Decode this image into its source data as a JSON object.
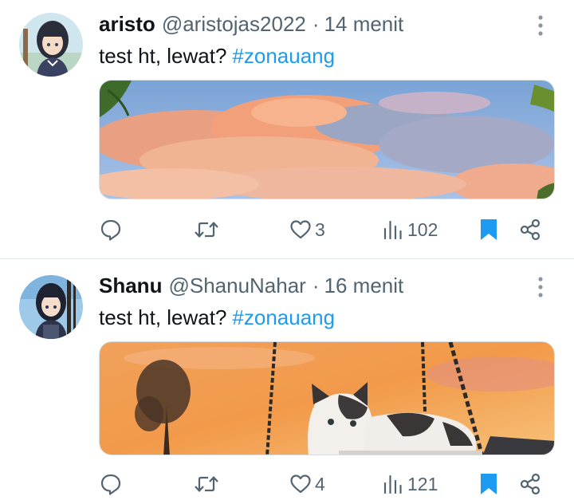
{
  "tweets": [
    {
      "display_name": "aristo",
      "handle": "@aristojas2022",
      "separator": "·",
      "time": "14 menit",
      "text": "test ht, lewat?",
      "hashtag": "#zonauang",
      "media_description": "sunset-clouds-photo",
      "reply_icon": "reply-icon",
      "retweet_icon": "retweet-icon",
      "like_icon": "heart-icon",
      "like_count": "3",
      "views_icon": "views-icon",
      "view_count": "102",
      "bookmark_icon": "bookmark-icon",
      "bookmark_color": "#1d9bf0",
      "share_icon": "share-icon"
    },
    {
      "display_name": "Shanu",
      "handle": "@ShanuNahar",
      "separator": "·",
      "time": "16 menit",
      "text": "test ht, lewat?",
      "hashtag": "#zonauang",
      "media_description": "kitten-on-swing-sunset-photo",
      "reply_icon": "reply-icon",
      "retweet_icon": "retweet-icon",
      "like_icon": "heart-icon",
      "like_count": "4",
      "views_icon": "views-icon",
      "view_count": "121",
      "bookmark_icon": "bookmark-icon",
      "bookmark_color": "#1d9bf0",
      "share_icon": "share-icon"
    }
  ],
  "colors": {
    "text": "#0f1419",
    "secondary": "#536471",
    "accent": "#1d9bf0",
    "divider": "#e1e6ea"
  }
}
